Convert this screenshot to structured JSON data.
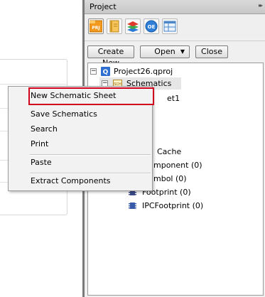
{
  "panel": {
    "title": "Project",
    "collapse_glyph": "▸▸",
    "toolbar": [
      {
        "name": "project-icon",
        "label": "PRJ"
      },
      {
        "name": "book-icon"
      },
      {
        "name": "layers-icon"
      },
      {
        "name": "output-icon",
        "label": "OE"
      },
      {
        "name": "table-icon"
      }
    ],
    "buttons": {
      "create_new": "Create New",
      "open": "Open",
      "close": "Close"
    }
  },
  "tree": {
    "project": "Project26.qproj",
    "schematics": "Schematics",
    "sheet_partial": "et1",
    "cache_partial": "Cache",
    "component_partial": "mponent (0)",
    "symbol_partial": "mbol (0)",
    "footprint_partial": "Footprint (0)",
    "ipc_footprint": "IPCFootprint (0)",
    "expand_minus": "−"
  },
  "context_menu": {
    "items": [
      "New Schematic Sheet",
      "Save Schematics",
      "Search",
      "Print",
      "Paste",
      "Extract Components"
    ],
    "highlight_color": "#d0001c"
  }
}
